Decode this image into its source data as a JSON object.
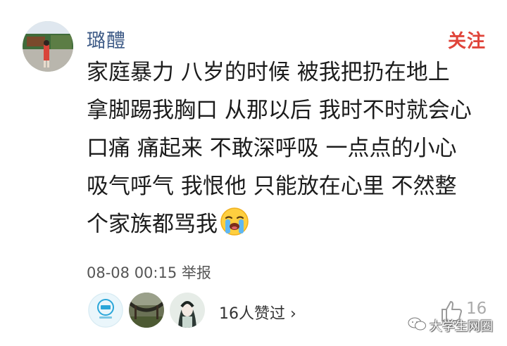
{
  "user": {
    "name": "璐醴"
  },
  "header": {
    "follow_label": "关注"
  },
  "post": {
    "lines": [
      "家庭暴力 八岁的时候 被我把扔在地上",
      "拿脚踢我胸口 从那以后 我时不时就会心",
      "口痛 痛起来 不敢深呼吸 一点点的小心",
      "吸气呼气 我恨他 只能放在心里 不然整",
      "个家族都骂我"
    ],
    "emoji": "crying-face"
  },
  "meta": {
    "timestamp": "08-08 00:15",
    "report_label": "举报"
  },
  "likes": {
    "liker_avatars": [
      "timi-logo-avatar",
      "hammock-photo-avatar",
      "ink-portrait-avatar"
    ],
    "summary": "16人赞过 ›",
    "count": "16"
  },
  "watermark": {
    "text": "大学生网圈"
  },
  "colors": {
    "username": "#3d5a86",
    "follow": "#e0443a",
    "text": "#1c1c1c"
  }
}
